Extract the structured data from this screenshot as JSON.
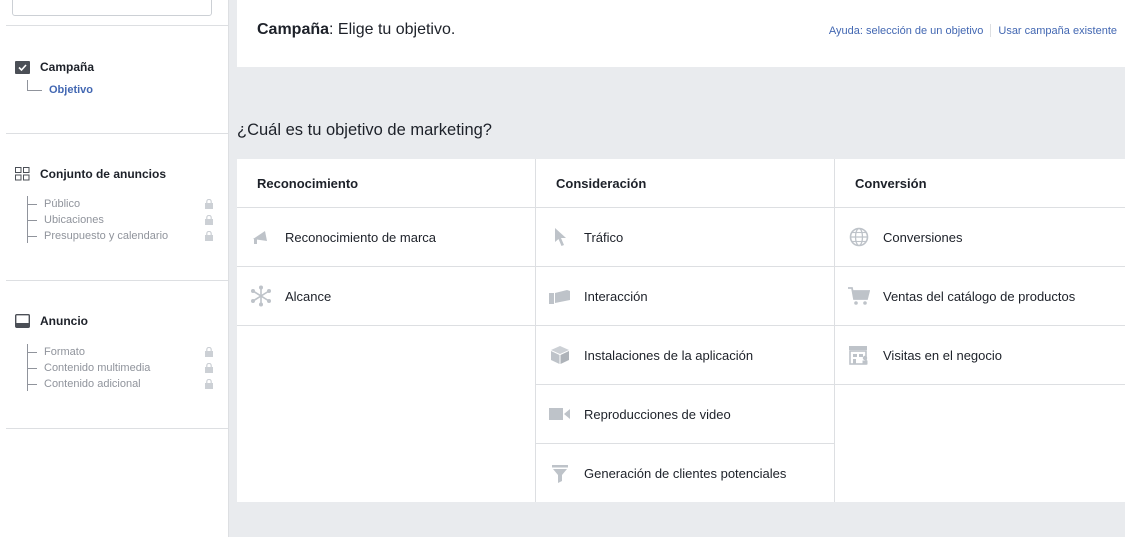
{
  "sidebar": {
    "campaign": {
      "heading": "Campaña",
      "items": [
        {
          "label": "Objetivo"
        }
      ]
    },
    "adset": {
      "heading": "Conjunto de anuncios",
      "items": [
        {
          "label": "Público"
        },
        {
          "label": "Ubicaciones"
        },
        {
          "label": "Presupuesto y calendario"
        }
      ]
    },
    "ad": {
      "heading": "Anuncio",
      "items": [
        {
          "label": "Formato"
        },
        {
          "label": "Contenido multimedia"
        },
        {
          "label": "Contenido adicional"
        }
      ]
    }
  },
  "header": {
    "title_bold": "Campaña",
    "title_rest": ": Elige tu objetivo.",
    "help_link": "Ayuda: selección de un objetivo",
    "existing_link": "Usar campaña existente"
  },
  "question": "¿Cuál es tu objetivo de marketing?",
  "columns": [
    {
      "heading": "Reconocimiento",
      "objectives": [
        {
          "label": "Reconocimiento de marca",
          "icon": "megaphone-icon"
        },
        {
          "label": "Alcance",
          "icon": "reach-icon"
        }
      ]
    },
    {
      "heading": "Consideración",
      "objectives": [
        {
          "label": "Tráfico",
          "icon": "cursor-icon"
        },
        {
          "label": "Interacción",
          "icon": "engagement-icon"
        },
        {
          "label": "Instalaciones de la aplicación",
          "icon": "box-icon"
        },
        {
          "label": "Reproducciones de video",
          "icon": "video-icon"
        },
        {
          "label": "Generación de clientes potenciales",
          "icon": "funnel-icon"
        }
      ]
    },
    {
      "heading": "Conversión",
      "objectives": [
        {
          "label": "Conversiones",
          "icon": "globe-icon"
        },
        {
          "label": "Ventas del catálogo de productos",
          "icon": "cart-icon"
        },
        {
          "label": "Visitas en el negocio",
          "icon": "store-icon"
        }
      ]
    }
  ],
  "colors": {
    "accent": "#4267b2",
    "icon_gray": "#bec3c9",
    "border": "#dddfe2",
    "background": "#e9ebee"
  }
}
